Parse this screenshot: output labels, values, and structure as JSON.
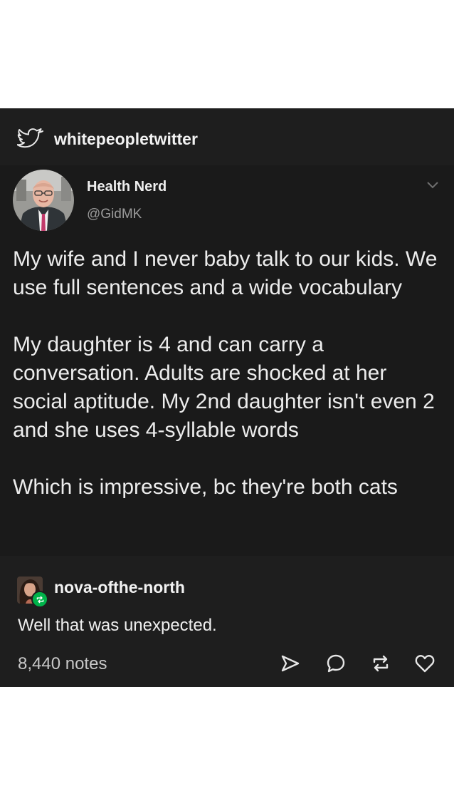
{
  "post": {
    "blog_name": "whitepeopletwitter",
    "blog_icon": "twitter-bird-icon"
  },
  "tweet": {
    "display_name": "Health Nerd",
    "handle": "@GidMK",
    "paragraphs": [
      "My wife and I never baby talk to our kids. We use full sentences and a wide vocabulary",
      "My daughter is 4 and can carry a conversation. Adults are shocked at her social aptitude. My 2nd daughter isn't even 2 and she uses 4-syllable words",
      "Which is impressive, bc they're both cats"
    ],
    "menu_icon": "chevron-down-icon"
  },
  "reblog": {
    "username": "nova-ofthe-north",
    "badge_icon": "reblog-icon",
    "comment": "Well that was unexpected."
  },
  "footer": {
    "notes": "8,440 notes",
    "actions": [
      "share-icon",
      "reply-icon",
      "reblog-icon",
      "like-icon"
    ]
  },
  "colors": {
    "post_background": "#1e1e1e",
    "tweet_background": "#1a1a1a",
    "reblog_badge": "#00b34a"
  }
}
